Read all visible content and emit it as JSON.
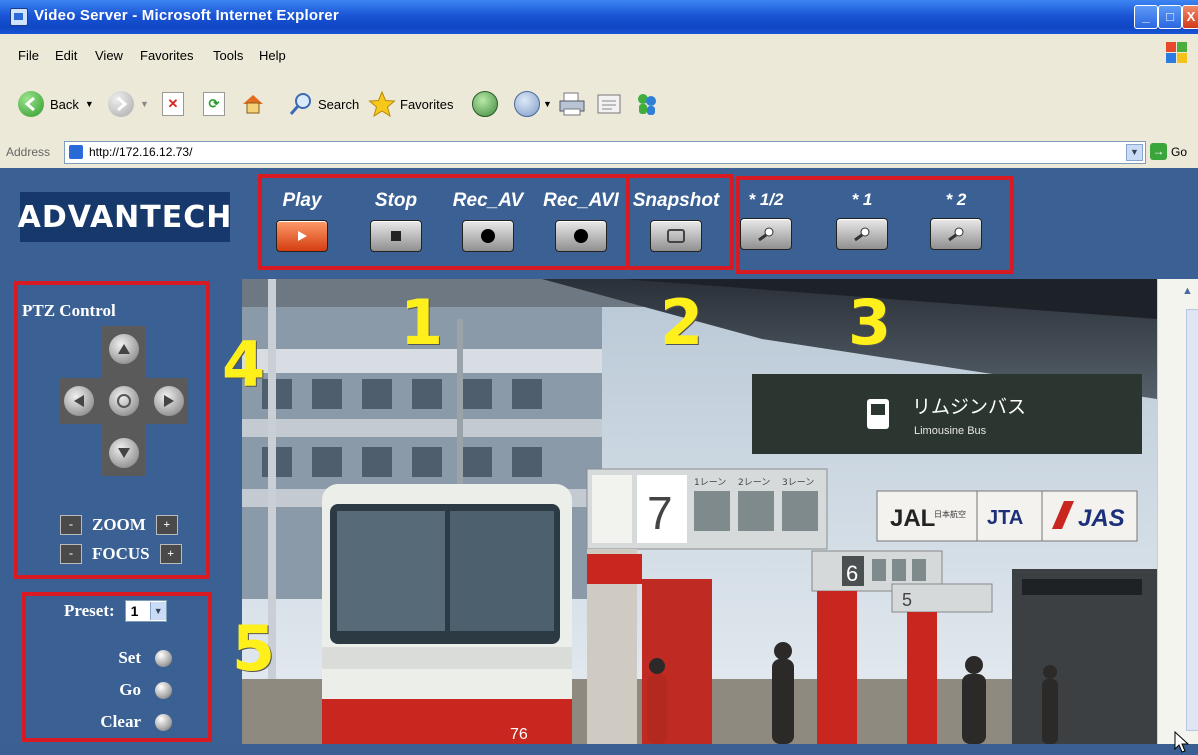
{
  "window": {
    "title": "Video Server - Microsoft Internet Explorer",
    "min": "_",
    "max": "□",
    "close": "X"
  },
  "menu": [
    "File",
    "Edit",
    "View",
    "Favorites",
    "Tools",
    "Help"
  ],
  "toolbar": {
    "back": "Back",
    "search": "Search",
    "favorites": "Favorites"
  },
  "address": {
    "label": "Address",
    "url": "http://172.16.12.73/",
    "go": "Go"
  },
  "brand": {
    "logo": "ADVANTECH"
  },
  "controls": {
    "play": "Play",
    "stop": "Stop",
    "rec_av": "Rec_AV",
    "rec_avi": "Rec_AVI",
    "snapshot": "Snapshot",
    "zoom_half": "* 1/2",
    "zoom_1": "* 1",
    "zoom_2": "* 2"
  },
  "annotations": {
    "n1": "1",
    "n2": "2",
    "n3": "3",
    "n4": "4",
    "n5": "5"
  },
  "ptz": {
    "title": "PTZ Control",
    "zoom": "ZOOM",
    "focus": "FOCUS",
    "minus": "-",
    "plus": "+"
  },
  "preset": {
    "label": "Preset:",
    "value": "1",
    "set": "Set",
    "go": "Go",
    "clear": "Clear"
  },
  "video": {
    "platform_sign_7": "7",
    "platform_sign_6": "6",
    "platform_sign_5": "5",
    "lane_labels": [
      "1レーン",
      "2レーン",
      "3レーン"
    ],
    "bus_sign_jp": "リムジンバス",
    "bus_sign_en": "Limousine Bus",
    "logo_jal": "JAL",
    "logo_jal_jp": "日本航空",
    "logo_jta": "JTA",
    "logo_jas": "JAS",
    "bus_number": "76"
  },
  "colors": {
    "annotation_box": "#d81b23",
    "annotation_number": "#ffef1a",
    "page_bg": "#3b6094",
    "logo_bg": "#17386b"
  }
}
